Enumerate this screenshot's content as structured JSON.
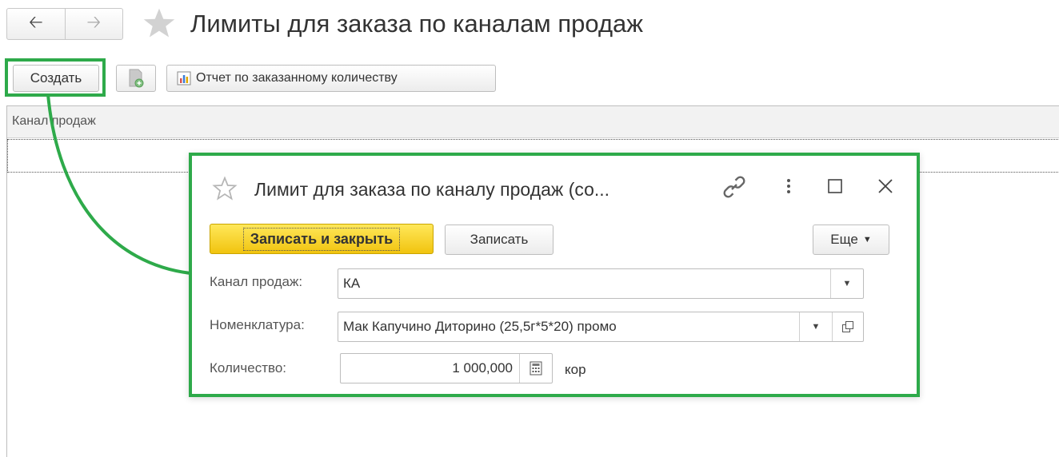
{
  "window": {
    "title": "Лимиты для заказа по каналам продаж"
  },
  "toolbar": {
    "create_label": "Создать",
    "report_label": "Отчет по заказанному количеству"
  },
  "list": {
    "columns": [
      "Канал продаж"
    ]
  },
  "dialog": {
    "title": "Лимит для заказа по каналу продаж (со...",
    "save_close_label": "Записать и закрыть",
    "save_label": "Записать",
    "more_label": "Еще",
    "fields": {
      "channel": {
        "label": "Канал продаж:",
        "value": "КА"
      },
      "nomenclature": {
        "label": "Номенклатура:",
        "value": "Мак Капучино Диторино (25,5г*5*20) промо"
      },
      "quantity": {
        "label": "Количество:",
        "value": "1 000,000",
        "unit": "кор"
      }
    }
  },
  "colors": {
    "highlight": "#2eaa4a",
    "primary_button": "#f1c40f"
  }
}
